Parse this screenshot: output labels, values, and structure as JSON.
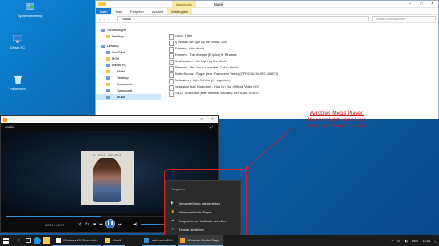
{
  "desktop": {
    "icons": [
      {
        "label": "Systemsteuerung",
        "icon": "control-panel-icon"
      },
      {
        "label": "Dieser PC",
        "icon": "this-pc-icon"
      },
      {
        "label": "Papierkorb",
        "icon": "recycle-bin-icon"
      }
    ]
  },
  "explorer": {
    "context_tab": "Musiktools",
    "title": "Musik",
    "tabs": [
      "Datei",
      "Start",
      "Freigeben",
      "Ansicht",
      "Wiedergabe"
    ],
    "path": "› Musik",
    "search_placeholder": "\"Musik\" durchsuchen",
    "nav": [
      {
        "label": "Schnellzugriff",
        "level": 1
      },
      {
        "label": "Desktop",
        "level": 2
      },
      {
        "label": "Desktop",
        "level": 1
      },
      {
        "label": "OneDrive",
        "level": 2
      },
      {
        "label": "MGH",
        "level": 2
      },
      {
        "label": "Dieser PC",
        "level": 2
      },
      {
        "label": "Bilder",
        "level": 3
      },
      {
        "label": "Desktop",
        "level": 3
      },
      {
        "label": "Dokumente",
        "level": 3
      },
      {
        "label": "Downloads",
        "level": 3
      },
      {
        "label": "Musik",
        "level": 3
      }
    ],
    "files": [
      "Cueo - I Bel",
      "dj mobalo we light up the world - vol4",
      "Eminem - Not Afraid",
      "Eminem - The Monster (Explicit) ft. Rihanna",
      "Multifemales - We Light up the World",
      "Rihanna - We Found Love feat. Calvin Harris",
      "Robin Schulz - Sugar (feat. Francesco Yates) (OFFICIAL MUSIC VIDEO)",
      "Sebastien - High On You (ft. Hagedorn)",
      "Sebastian feat. Hagedorn - High On You (Official Video HD)",
      "SIDO - Astronaut (feat. Andreas Bourani) OFFICIAL VIDEO"
    ]
  },
  "player": {
    "subtitle": "Jackie",
    "cover_text": "CIARA JACKIE",
    "time": "02:21 / 05:07",
    "progress": 0.46,
    "volume": 0.55
  },
  "jumplist": {
    "header": "Aufgaben",
    "items": [
      {
        "label": "Gesamte Musik wiedergeben",
        "icon": "play-icon"
      },
      {
        "label": "Windows Media Player",
        "icon": "media-player-icon"
      },
      {
        "label": "Programm an Taskleiste anheften",
        "icon": "pin-icon"
      },
      {
        "label": "Fenster schließen",
        "icon": "close-icon"
      }
    ]
  },
  "annotation": {
    "line1": "Windows Media Player:",
    "line2": "Hier erscheint keine Liste",
    "line3": "zuletzt geöffneter Dateien",
    "color": "#c41a1a"
  },
  "taskbar": {
    "tasks": [
      {
        "label": "Windows 10: Screensh...",
        "color": "#ffffff"
      },
      {
        "label": "Musik",
        "color": "#f2c94c"
      },
      {
        "label": "paint.net v4.0.6",
        "color": "#3a8fd8"
      },
      {
        "label": "Windows Media Player",
        "color": "#f0a030"
      }
    ],
    "lang": "DEU",
    "time": "13:53"
  }
}
